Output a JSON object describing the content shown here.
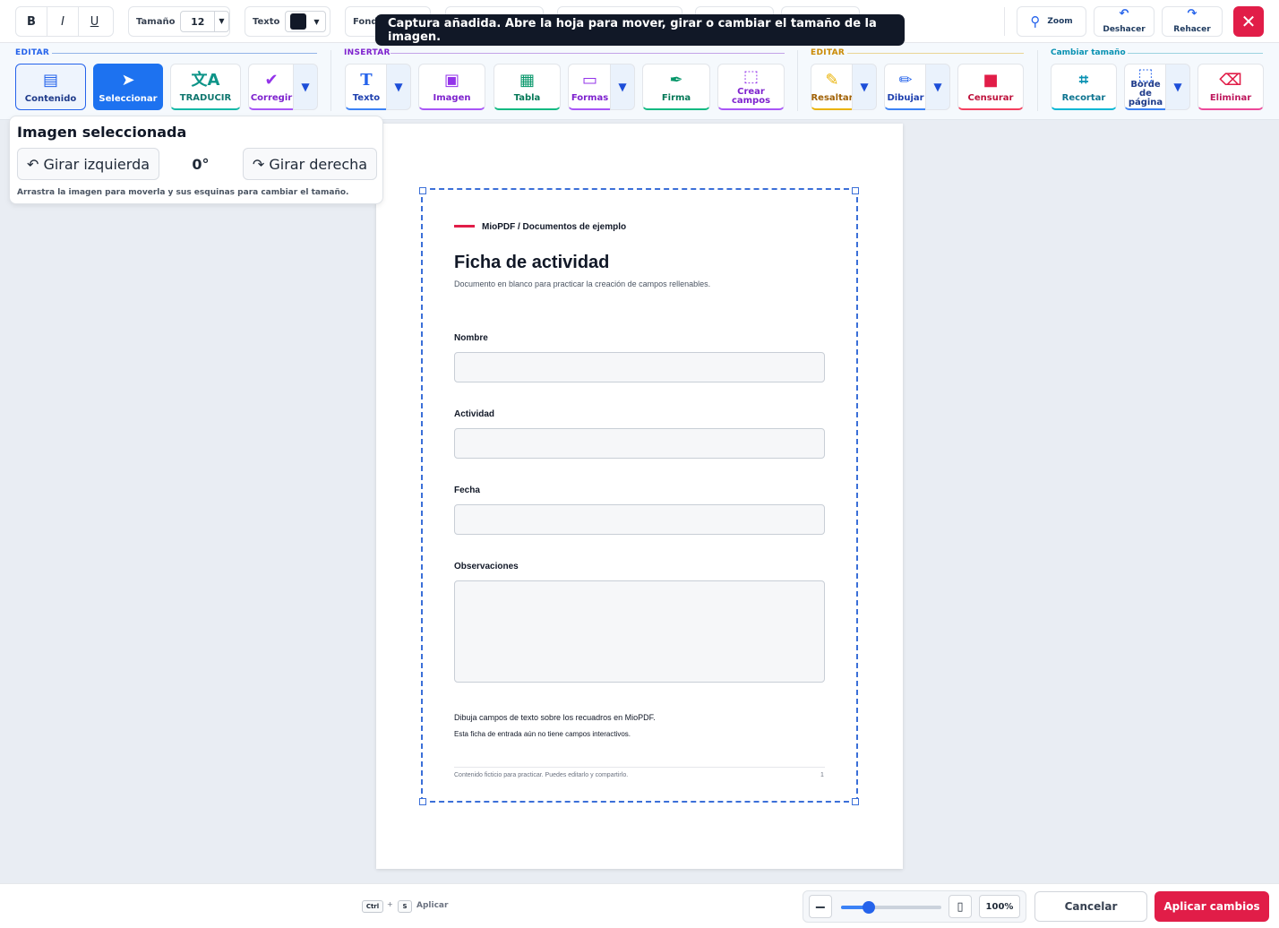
{
  "format": {
    "bold": "B",
    "italic": "I",
    "underline": "U",
    "size_label": "Tamaño",
    "size_value": "12",
    "text_label": "Texto",
    "text_color": "#111827",
    "bg_label": "Fondo"
  },
  "history": {
    "zoom": "Zoom",
    "undo": "Deshacer",
    "redo": "Rehacer"
  },
  "toast": "Captura añadida. Abre la hoja para mover, girar o cambiar el tamaño de la imagen.",
  "ribbon": {
    "edit_title": "EDITAR",
    "insert_title": "INSERTAR",
    "edit2_title": "EDITAR",
    "resize_title": "Cambiar tamaño",
    "contenido": "Contenido",
    "seleccionar": "Seleccionar",
    "traducir": "TRADUCIR",
    "corregir": "Corregir",
    "texto": "Texto",
    "imagen": "Imagen",
    "tabla": "Tabla",
    "formas": "Formas",
    "firma": "Firma",
    "crear_campos_1": "Crear",
    "crear_campos_2": "campos",
    "resaltar": "Resaltar",
    "dibujar": "Dibujar",
    "censurar": "Censurar",
    "recortar": "Recortar",
    "borde_1": "Borde",
    "borde_2": "de",
    "borde_3": "página",
    "eliminar": "Eliminar"
  },
  "panel": {
    "title": "Imagen seleccionada",
    "rotate_left": "↶ Girar izquierda",
    "angle": "0°",
    "rotate_right": "↷ Girar derecha",
    "hint": "Arrastra la imagen para moverla y sus esquinas para cambiar el tamaño."
  },
  "document": {
    "brand": "MioPDF / Documentos de ejemplo",
    "title": "Ficha de actividad",
    "subtitle": "Documento en blanco para practicar la creación de campos rellenables.",
    "field_nombre": "Nombre",
    "field_actividad": "Actividad",
    "field_fecha": "Fecha",
    "field_observaciones": "Observaciones",
    "note1": "Dibuja campos de texto sobre los recuadros en MioPDF.",
    "note2": "Esta ficha de entrada aún no tiene campos interactivos.",
    "footer": "Contenido ficticio para practicar. Puedes editarlo y compartirlo.",
    "page_number": "1"
  },
  "bottom": {
    "kbd_ctrl": "Ctrl",
    "kbd_plus": "+",
    "kbd_s": "S",
    "kbd_action": "Aplicar",
    "zoom_value": "100%",
    "zoom_fraction": 0.28,
    "cancel": "Cancelar",
    "apply": "Aplicar cambios"
  },
  "colors": {
    "accent": "#2563eb",
    "danger": "#e11d48",
    "edit": "#2563eb",
    "insert": "#7e22ce",
    "edit2": "#ca8a04",
    "resize": "#0891b2"
  }
}
